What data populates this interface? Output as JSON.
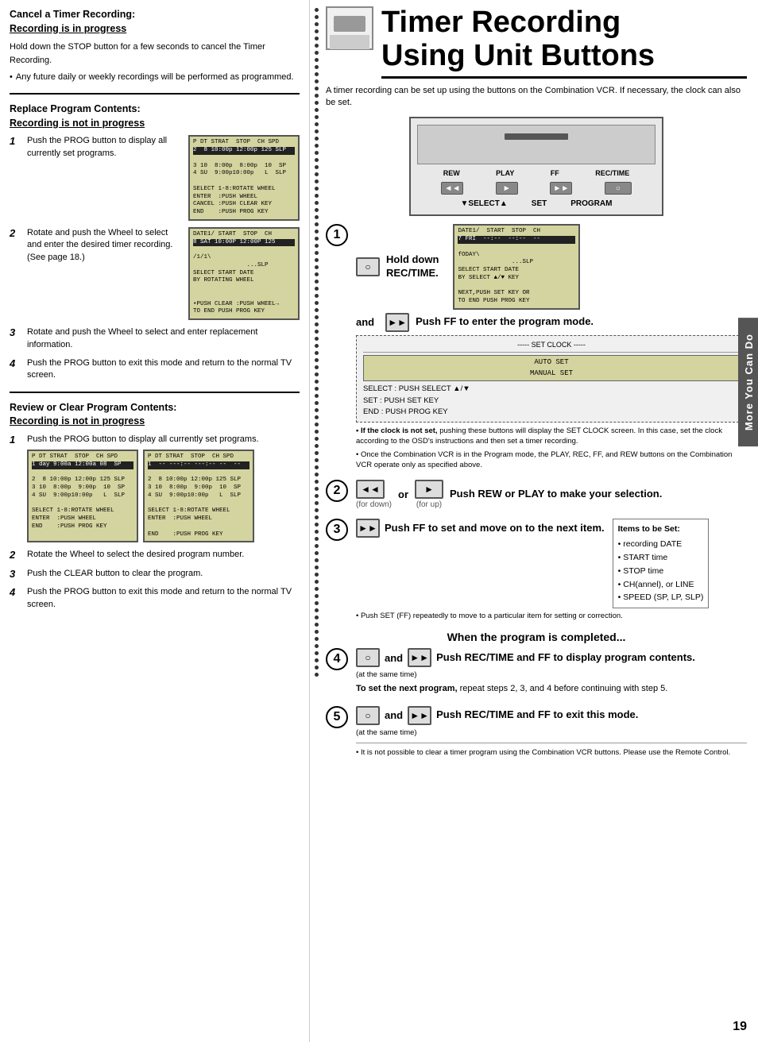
{
  "page": {
    "number": "19",
    "right_tab": "More You Can Do"
  },
  "left_col": {
    "section1": {
      "title": "Cancel a Timer Recording:",
      "title2": "Recording is in progress",
      "underline_word": "is",
      "body": "Hold down the STOP button for a few seconds to cancel the Timer Recording.",
      "bullet": "Any future daily or weekly recordings will be performed as programmed."
    },
    "section2": {
      "title": "Replace Program Contents:",
      "title2": "Recording is not in progress",
      "underline_word": "is not",
      "steps": [
        {
          "num": "1",
          "text": "Push the PROG button to display all currently set programs.",
          "lcd": "P DT STRAT  STOP  CH SPD\n2  8 10:00p 12:00p 125 SLP\n3 10  8:00p  8:00p  10  SP\n4 SU  9:00p10:00p   L  SLP\n\nSELECT 1-8:ROTATE WHEEL\nENTER  :PUSH WHEEL\nCANCEL :PUSH CLEAR KEY\nEND    :PUSH PROG KEY"
        },
        {
          "num": "2",
          "text": "Rotate and push the Wheel to select and enter the desired timer recording. (See page 18.)",
          "lcd": "DATE1/ START  STOP  CH\n8 SAT 10:00P 12:00P 125\n/1/1\\                 \n               ...SLP\nSELECT START DATE\nBY ROTATING WHEEL\n\n•PUSH CLEAR :PUSH WHEEL→\nTO END PUSH PROG KEY"
        },
        {
          "num": "3",
          "text": "Rotate and push the Wheel to select and enter replacement information."
        },
        {
          "num": "4",
          "text": "Push the PROG button to exit this mode and return to the normal TV screen."
        }
      ]
    },
    "section3": {
      "title": "Review or Clear Program Contents:",
      "title2": "Recording is not in progress",
      "underline_word": "is not",
      "steps": [
        {
          "num": "1",
          "text": "Push the PROG button to display all currently set programs.",
          "lcd1": "P DT STRAT  STOP  CH SPD\n1 day 9:00a 12:00a 08  SP\n2  8 10:00p 12:00p 125 SLP\n3 10  8:00p  9:00p  10  SP\n4 SU  9:00p10:00p   L  SLP\n\nSELECT 1-8:ROTATE WHEEL\nENTER  :PUSH WHEEL\nEND    :PUSH PROG KEY",
          "lcd2": "P DT STRAT  STOP  CH SPD\n1  -- ---:-- ---:-- --  --\n2  8 10:00p 12:00p 125 SLP\n3 10  8:00p  9:00p  10  SP\n4 SU  9:00p10:00p   L  SLP\n\nSELECT 1-8:ROTATE WHEEL\nENTER  :PUSH WHEEL\n\nEND    :PUSH PROG KEY"
        },
        {
          "num": "2",
          "text": "Rotate the Wheel to select the desired program number."
        },
        {
          "num": "3",
          "text": "Push the CLEAR button to clear the program."
        },
        {
          "num": "4",
          "text": "Push the PROG button to exit this mode and return to the normal TV screen."
        }
      ]
    }
  },
  "right_col": {
    "title_line1": "Timer Recording",
    "title_line2": "Using Unit Buttons",
    "intro": "A timer recording can be set up using the buttons on the Combination VCR. If necessary, the clock can also be set.",
    "vcr_controls": {
      "labels": [
        "REW",
        "PLAY",
        "FF",
        "REC/TIME"
      ],
      "select_label": "▼SELECT▲",
      "set_label": "SET",
      "program_label": "PROGRAM"
    },
    "steps": [
      {
        "num": "1",
        "actions": [
          "REC/TIME button",
          "FF button"
        ],
        "hold_text": "Hold down REC/TIME.",
        "and_text": "and",
        "push_text": "Push FF to enter the program mode.",
        "lcd": "DATE1/  START  STOP  CH\n7 FRI  --:--  --:--  --\nfODAY\\               \n               ...SLP\nSELECT START DATE\nBY SELECT ▲/▼ KEY\n\nNEXT,PUSH SET KEY OR\nTO END PUSH PROG KEY",
        "note_title": "---- SET CLOCK -----",
        "auto_set_text": "AUTO SET\nMANUAL SET",
        "note_lines": [
          "SELECT : PUSH SELECT ▲/▼",
          "SET    : PUSH SET KEY",
          "END    : PUSH PROG KEY"
        ],
        "if_clock_note": "• If the clock is not set, pushing these buttons will display the SET CLOCK screen. In this case, set the clock according to the OSD's instructions and then set a timer recording.",
        "once_note": "• Once the Combination VCR is in the Program mode, the PLAY, REC, FF, and REW buttons on the Combination VCR operate only as specified above."
      },
      {
        "num": "2",
        "desc": "Push REW or PLAY to make your selection.",
        "for_down": "(for down)",
        "for_up": "(for up)"
      },
      {
        "num": "3",
        "desc": "Push FF to set and move on to the next item.",
        "items_title": "Items to be Set:",
        "items": [
          "• recording DATE",
          "• START time",
          "• STOP time",
          "• CH(annel), or LINE",
          "• SPEED (SP, LP, SLP)"
        ],
        "small_note": "• Push SET (FF) repeatedly to move to a particular item for setting or correction."
      },
      {
        "when_complete": "When the program is completed..."
      },
      {
        "num": "4",
        "desc": "Push REC/TIME and FF to display program contents.",
        "at_same_time": "(at the same time)",
        "to_set_next_bold": "To set the next program,",
        "to_set_next_rest": "repeat steps 2, 3, and 4 before continuing with step 5."
      },
      {
        "num": "5",
        "desc": "Push REC/TIME and FF to exit this mode.",
        "at_same_time": "(at the same time)",
        "footnote": "• It is not possible to clear a timer program using the Combination VCR buttons. Please use the Remote Control."
      }
    ]
  }
}
